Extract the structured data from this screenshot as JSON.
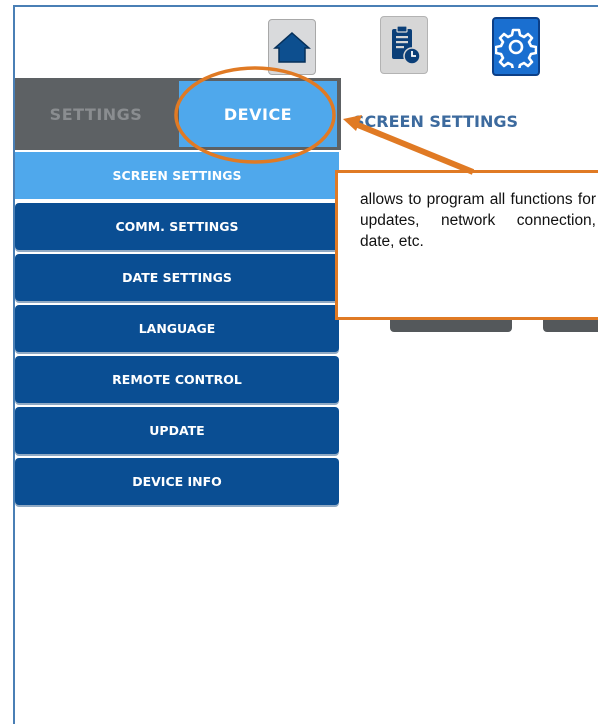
{
  "toolbar": {
    "home_icon": "home-icon",
    "history_icon": "clipboard-clock-icon",
    "settings_icon": "gear-icon"
  },
  "tabs": [
    {
      "label": "SETTINGS",
      "active": false
    },
    {
      "label": "DEVICE",
      "active": true
    }
  ],
  "menu": {
    "items": [
      {
        "label": "SCREEN SETTINGS",
        "active": true
      },
      {
        "label": "COMM. SETTINGS",
        "active": false
      },
      {
        "label": "DATE SETTINGS",
        "active": false
      },
      {
        "label": "LANGUAGE",
        "active": false
      },
      {
        "label": "REMOTE CONTROL",
        "active": false
      },
      {
        "label": "UPDATE",
        "active": false
      },
      {
        "label": "DEVICE INFO",
        "active": false
      }
    ]
  },
  "content": {
    "title": "SCREEN SETTINGS"
  },
  "annotation": {
    "text": "allows to program all functions for updates, network connection, date, etc.",
    "color": "#e07a24"
  },
  "colors": {
    "menu_bg": "#0a4e93",
    "active_bg": "#4fa8ec",
    "tabbar_bg": "#5d6164",
    "frame_border": "#4a7fb5"
  }
}
